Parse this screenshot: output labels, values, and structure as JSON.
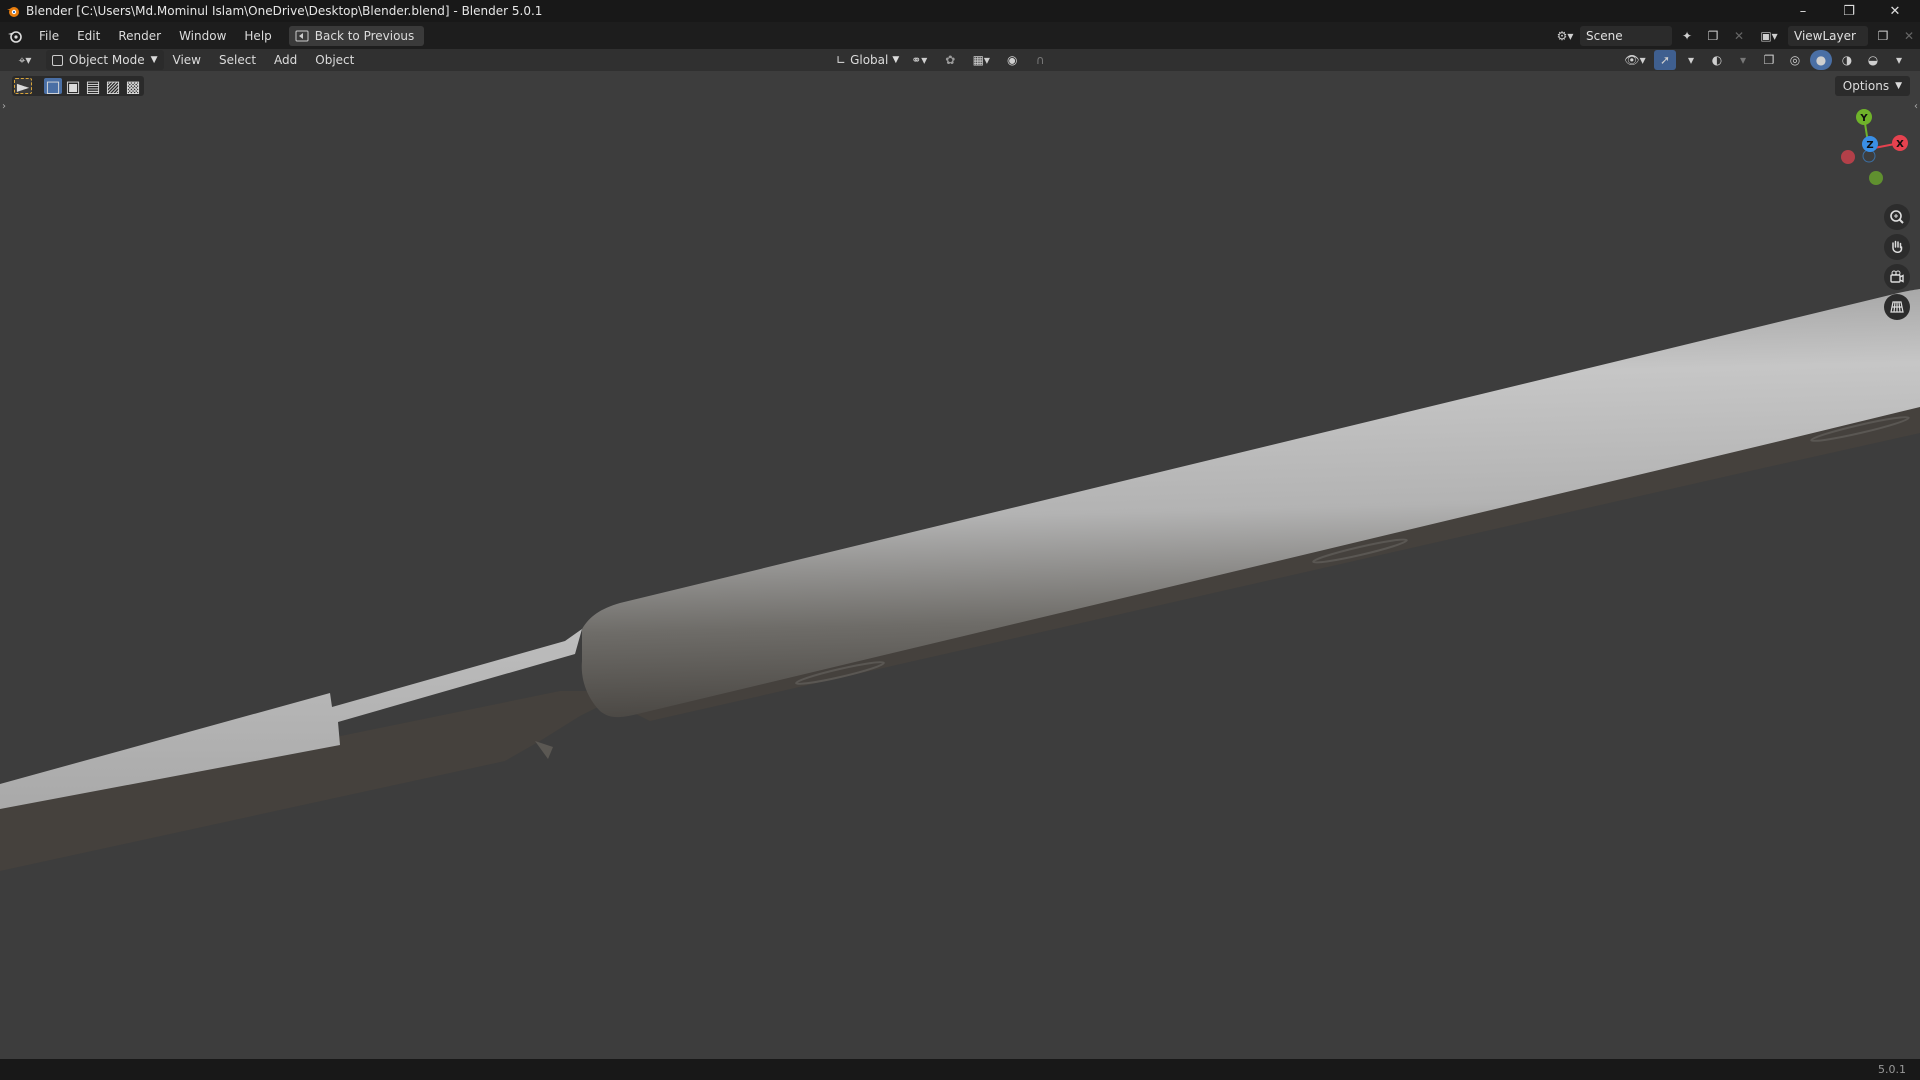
{
  "window": {
    "title": "Blender [C:\\Users\\Md.Mominul Islam\\OneDrive\\Desktop\\Blender.blend] - Blender 5.0.1",
    "controls": [
      "minimize-icon",
      "restore-icon",
      "close-icon"
    ]
  },
  "menubar": {
    "items": [
      "File",
      "Edit",
      "Render",
      "Window",
      "Help"
    ],
    "back_button": "Back to Previous",
    "scene": "Scene",
    "view_layer": "ViewLayer"
  },
  "header": {
    "mode": "Object Mode",
    "menus": [
      "View",
      "Select",
      "Add",
      "Object"
    ],
    "transform_orientation": "Global",
    "options_label": "Options"
  },
  "viewport": {
    "gizmo_axes": {
      "x": "X",
      "y": "Y",
      "z": "Z"
    },
    "colors": {
      "x_axis": "#e5424f",
      "y_axis": "#6fb32a",
      "z_axis": "#3a8fe6",
      "background": "#3d3d3d"
    }
  },
  "status": {
    "version": "5.0.1"
  }
}
